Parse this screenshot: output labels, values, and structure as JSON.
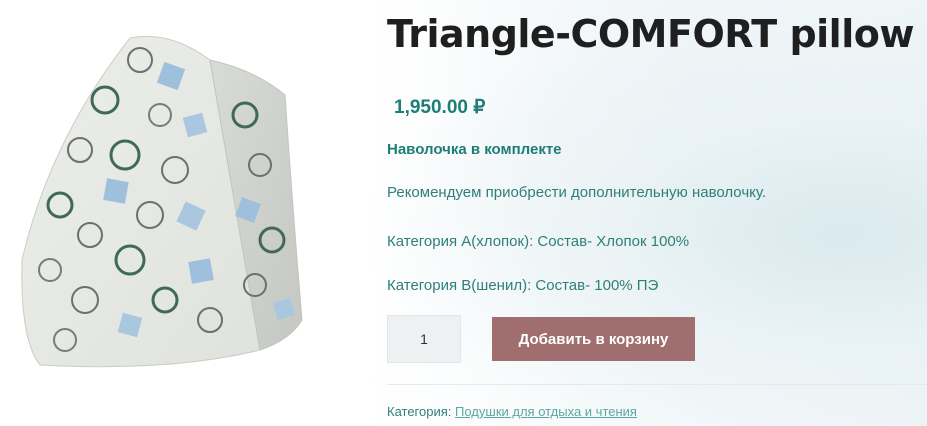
{
  "product": {
    "title": "Triangle-COMFORT pillow",
    "price": "1,950.00 ₽",
    "included_note": "Наволочка в комплекте",
    "description": [
      "Рекомендуем приобрести дополнительную наволочку.",
      "Категория А(хлопок): Состав- Хлопок 100%",
      "Категория В(шенил): Состав- 100% ПЭ"
    ],
    "image_icon": "triangle-pillow-product-photo"
  },
  "cart": {
    "quantity": "1",
    "add_to_cart_label": "Добавить в корзину"
  },
  "meta": {
    "category_label": "Категория:",
    "category_link": "Подушки для отдыха и чтения"
  },
  "colors": {
    "accent": "#1e7d76",
    "button": "#a06e6e",
    "title": "#1f1f1f"
  }
}
